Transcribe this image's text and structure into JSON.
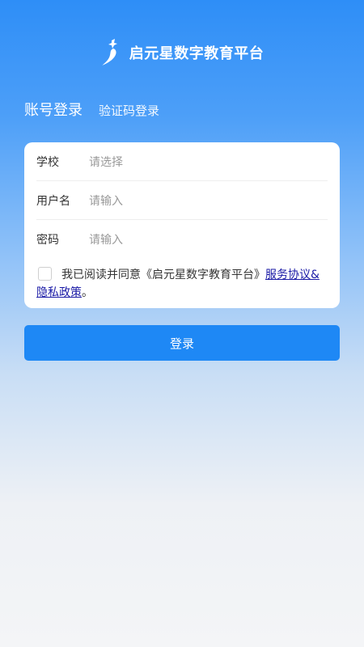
{
  "brand": {
    "title": "启元星数字教育平台",
    "logo": "star-person-logo"
  },
  "tabs": {
    "account": "账号登录",
    "sms": "验证码登录"
  },
  "form": {
    "school": {
      "label": "学校",
      "placeholder": "请选择"
    },
    "username": {
      "label": "用户名",
      "placeholder": "请输入"
    },
    "password": {
      "label": "密码",
      "placeholder": "请输入"
    }
  },
  "agreement": {
    "text": "我已阅读并同意《启元星数字教育平台》",
    "link_service": "服务协议&",
    "link_privacy": "隐私政策",
    "period": "。",
    "checked": false
  },
  "login_button": "登录",
  "colors": {
    "primary": "#1e88f5",
    "header_blue": "#2e8ef7",
    "link": "#1a1aa6"
  }
}
